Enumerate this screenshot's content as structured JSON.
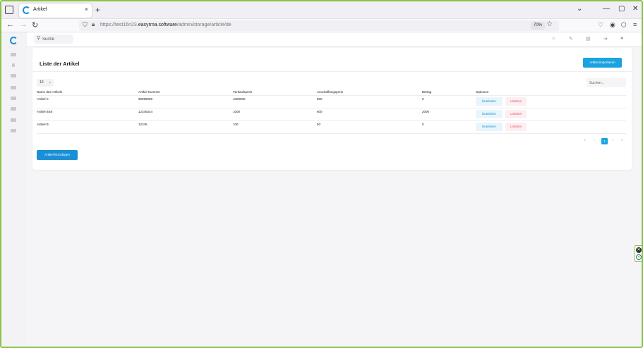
{
  "browser": {
    "tab_title": "Artikel",
    "tab_close": "×",
    "new_tab": "+",
    "controls": {
      "chevron": "⌄",
      "minimize": "—",
      "maximize": "▢",
      "close": "✕"
    },
    "nav": {
      "back": "←",
      "forward": "→",
      "reload": "↻"
    },
    "url_prefix": "https://test16n23.",
    "url_domain": "easyrma.software",
    "url_path": "/admin/storage/article/de",
    "zoom": "70%",
    "menu": "≡"
  },
  "app": {
    "search_placeholder": "Suche",
    "page_title": "Liste der Artikel",
    "import_button": "Artikel importieren",
    "per_page": "10",
    "table_search_placeholder": "Suchen...",
    "table": {
      "headers": [
        "Name des Artikels",
        "Artikel Nummer",
        "Verkaufspreis",
        "Anschaffungspreis",
        "Betrag",
        "Optionen"
      ],
      "rows": [
        [
          "Artikel X",
          "99999999",
          "1000000",
          "800",
          "0"
        ],
        [
          "Artikel BS6",
          "12345344",
          "1000",
          "800",
          "2000"
        ],
        [
          "Artikel B",
          "12345",
          "100",
          "50",
          "0"
        ]
      ],
      "edit_label": "bearbeiten",
      "delete_label": "Löschen"
    },
    "pagination": {
      "first": "«",
      "prev": "‹",
      "current": "1",
      "next": "›",
      "last": "»"
    },
    "add_button": "Artikel hinzufügen"
  },
  "colors": {
    "accent": "#1aa3e0",
    "danger": "#e0445f",
    "frame": "#8bc34a"
  }
}
